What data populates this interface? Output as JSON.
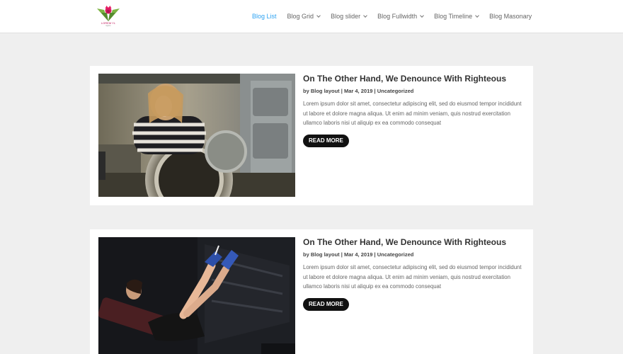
{
  "header": {
    "logo_text": "LOREM YL",
    "logo_sub": "tagline",
    "nav": [
      {
        "label": "Blog List",
        "active": true,
        "dropdown": false
      },
      {
        "label": "Blog Grid",
        "active": false,
        "dropdown": true
      },
      {
        "label": "Blog slider",
        "active": false,
        "dropdown": true
      },
      {
        "label": "Blog Fullwidth",
        "active": false,
        "dropdown": true
      },
      {
        "label": "Blog Timeline",
        "active": false,
        "dropdown": true
      },
      {
        "label": "Blog Masonary",
        "active": false,
        "dropdown": false
      }
    ]
  },
  "posts": [
    {
      "title": "On The Other Hand, We Denounce With Righteous",
      "author": "Blog layout",
      "date": "Mar 4, 2019",
      "category": "Uncategorized",
      "excerpt": "Lorem ipsum dolor sit amet, consectetur adipiscing elit, sed do eiusmod tempor incididunt ut labore et dolore magna aliqua. Ut enim ad minim veniam, quis nostrud exercitation ullamco laboris nisi ut aliquip ex ea commodo consequat",
      "read_more": "READ MORE"
    },
    {
      "title": "On The Other Hand, We Denounce With Righteous",
      "author": "Blog layout",
      "date": "Mar 4, 2019",
      "category": "Uncategorized",
      "excerpt": "Lorem ipsum dolor sit amet, consectetur adipiscing elit, sed do eiusmod tempor incididunt ut labore et dolore magna aliqua. Ut enim ad minim veniam, quis nostrud exercitation ullamco laboris nisi ut aliquip ex ea commodo consequat",
      "read_more": "READ MORE"
    }
  ],
  "colors": {
    "accent": "#2ea3f2",
    "button": "#111111",
    "background": "#efefef"
  }
}
